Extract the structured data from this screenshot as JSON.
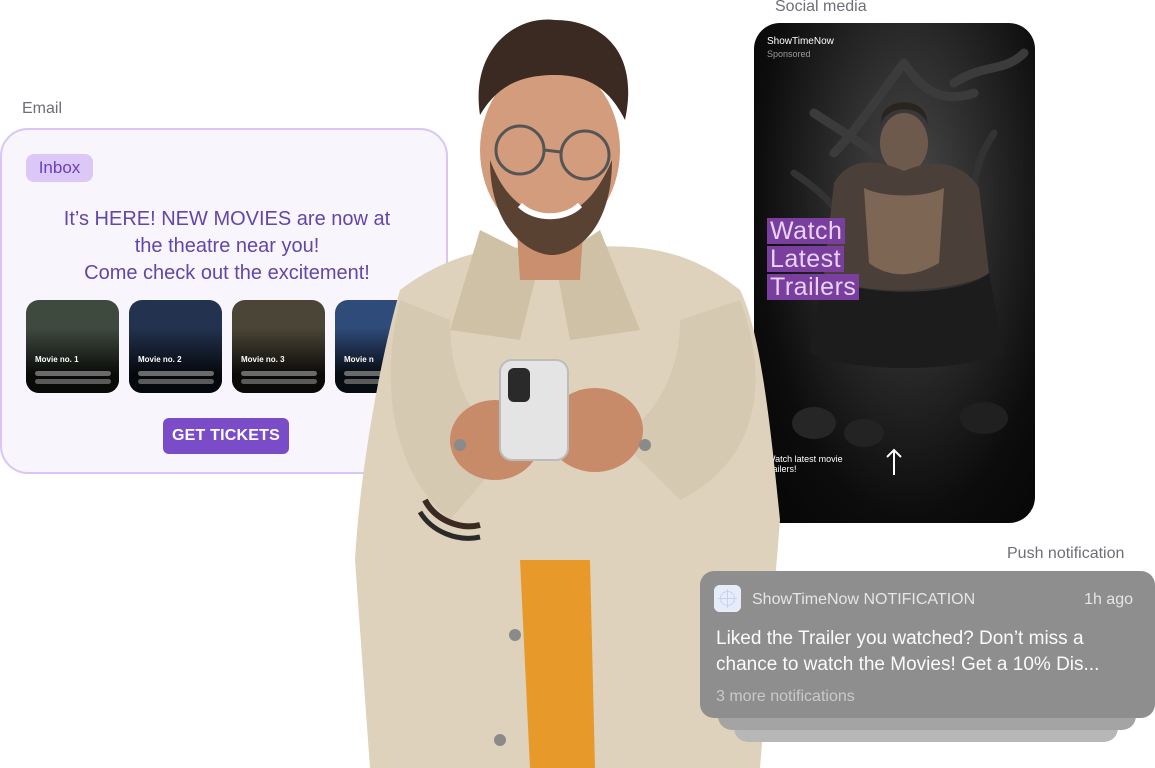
{
  "labels": {
    "email": "Email",
    "social": "Social media",
    "push": "Push notification"
  },
  "email": {
    "inbox_tag": "Inbox",
    "headline": [
      "It’s HERE! NEW MOVIES are now at",
      "the theatre near you!",
      "Come check out the excitement!"
    ],
    "movies": [
      {
        "label": "Movie no. 1",
        "color": "#3f4a3e"
      },
      {
        "label": "Movie no. 2",
        "color": "#23324f"
      },
      {
        "label": "Movie no. 3",
        "color": "#4a4537"
      },
      {
        "label": "Movie n",
        "color": "#2f4b7a"
      }
    ],
    "cta": "GET TICKETS"
  },
  "social": {
    "brand": "ShowTimeNow",
    "sponsored": "Sponsored",
    "overlay_lines": [
      "Watch",
      "Latest",
      "Trailers"
    ],
    "caption": "Watch latest movie trailers!",
    "arrow_icon": "arrow-up-icon"
  },
  "push": {
    "app_name": "ShowTimeNow NOTIFICATION",
    "time": "1h ago",
    "body_lines": [
      "Liked the Trailer you watched? Don’t miss a",
      "chance to watch the Movies! Get a 10% Dis..."
    ],
    "more": "3 more notifications"
  },
  "colors": {
    "accent": "#7a4cc8",
    "email_text": "#6247a6",
    "email_border": "#d8c6f6"
  }
}
